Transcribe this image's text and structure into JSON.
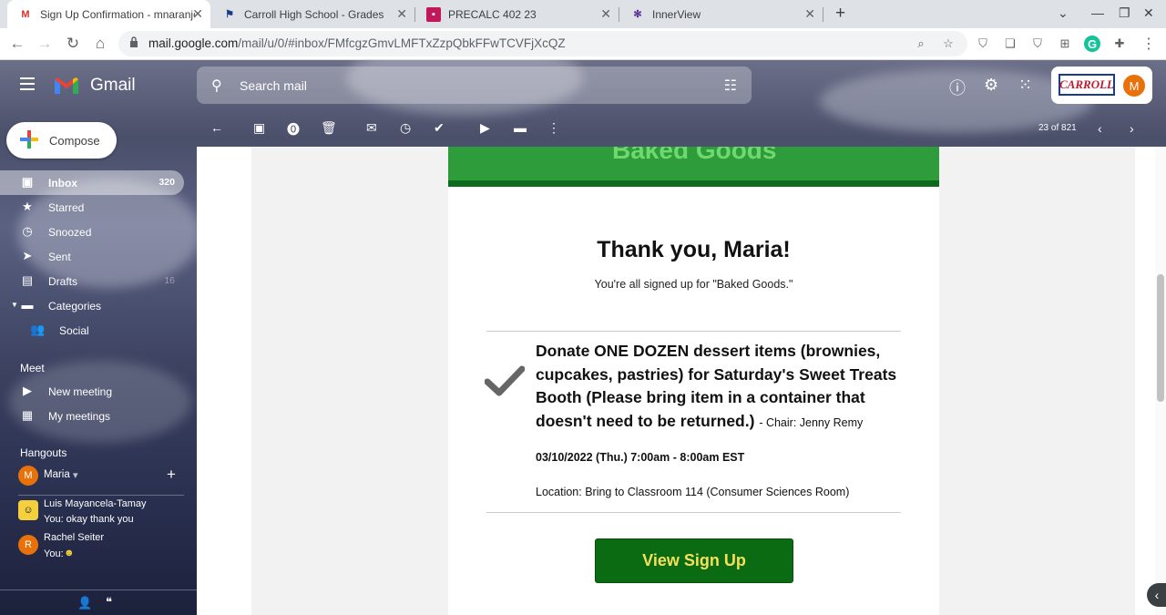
{
  "browser": {
    "tabs": [
      {
        "title": "Sign Up Confirmation - mnaranjo",
        "icon": "gmail-icon",
        "active": true
      },
      {
        "title": "Carroll High School - Grades",
        "icon": "school-icon",
        "active": false
      },
      {
        "title": "PRECALC 402 23",
        "icon": "classroom-icon",
        "active": false
      },
      {
        "title": "InnerView",
        "icon": "innerview-icon",
        "active": false
      }
    ],
    "new_tab": "+",
    "url_host": "mail.google.com",
    "url_path": "/mail/u/0/#inbox/FMfcgzGmvLMFTxZzpQbkFFwTCVFjXcQZ"
  },
  "gmail": {
    "app_name": "Gmail",
    "search_placeholder": "Search mail",
    "account_logo": "CARROLL",
    "account_initial": "M",
    "compose_label": "Compose",
    "nav": [
      {
        "label": "Inbox",
        "count": "320",
        "icon": "inbox-icon"
      },
      {
        "label": "Starred",
        "count": "",
        "icon": "star-icon"
      },
      {
        "label": "Snoozed",
        "count": "",
        "icon": "clock-icon"
      },
      {
        "label": "Sent",
        "count": "",
        "icon": "send-icon"
      },
      {
        "label": "Drafts",
        "count": "16",
        "icon": "draft-icon"
      },
      {
        "label": "Categories",
        "count": "",
        "icon": "label-icon"
      },
      {
        "label": "Social",
        "count": "",
        "icon": "people-icon"
      }
    ],
    "meet": {
      "heading": "Meet",
      "items": [
        "New meeting",
        "My meetings"
      ]
    },
    "hangouts": {
      "heading": "Hangouts",
      "self": "Maria",
      "contacts": [
        {
          "name": "Luis Mayancela-Tamay",
          "msg": "You: okay thank you"
        },
        {
          "name": "Rachel Seiter",
          "msg": "You:",
          "initial": "R"
        }
      ]
    },
    "pager": "23 of 821"
  },
  "email": {
    "banner": "Baked Goods",
    "thanks": "Thank you, Maria!",
    "signed": "You're all signed up for \"Baked Goods.\"",
    "item": "Donate ONE DOZEN dessert items (brownies, cupcakes, pastries) for Saturday's Sweet Treats Booth (Please bring item in a container that doesn't need to be returned.)",
    "chair": "- Chair: Jenny Remy",
    "date": "03/10/2022 (Thu.) 7:00am - 8:00am EST",
    "location": "Location: Bring to Classroom 114 (Consumer Sciences Room)",
    "button": "View Sign Up"
  },
  "colors": {
    "accent": "#0a6b12",
    "button_text": "#f6e05a",
    "banner": "#2e9c3a"
  }
}
